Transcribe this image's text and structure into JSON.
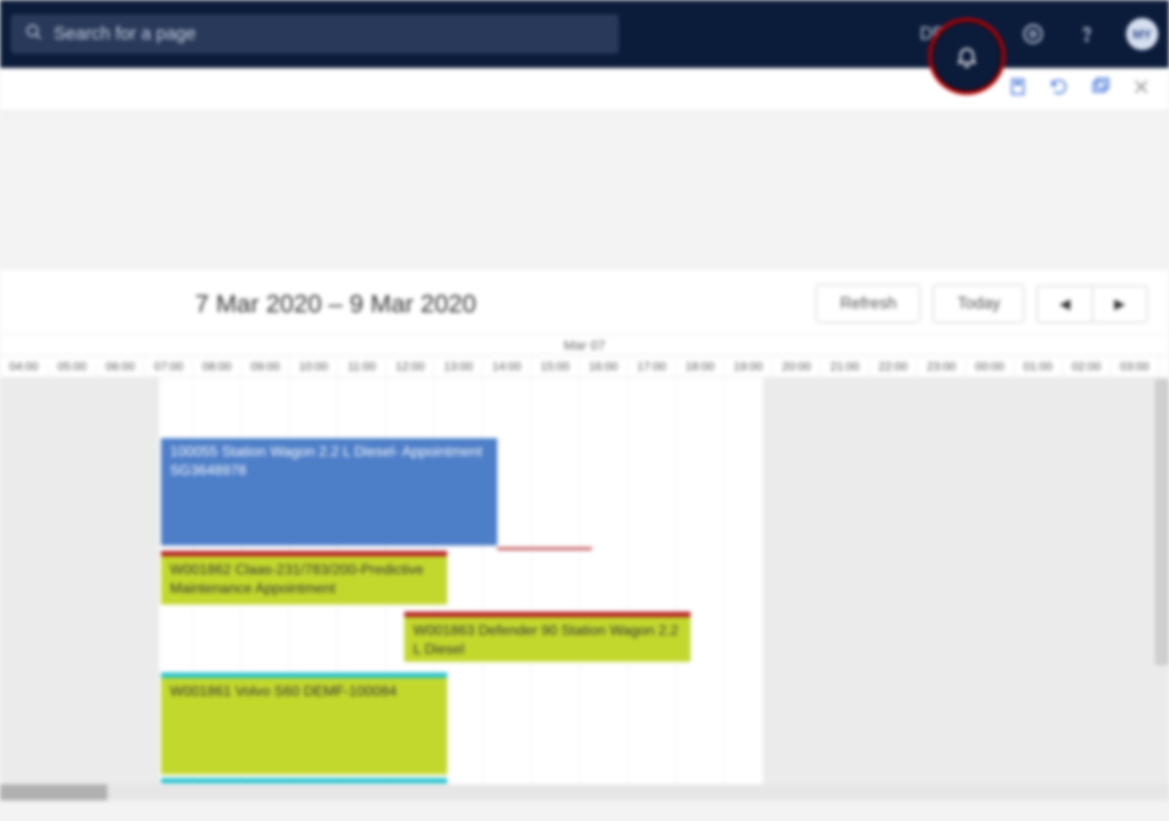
{
  "header": {
    "search_placeholder": "Search for a page",
    "company": "DEMF",
    "avatar": "MY"
  },
  "subtoolbar": {
    "office_icon": "office-icon",
    "refresh_icon": "refresh-icon",
    "window_icon": "popout-icon",
    "close_icon": "close-icon"
  },
  "scheduler": {
    "title": "7 Mar 2020 – 9 Mar 2020",
    "refresh_label": "Refresh",
    "today_label": "Today",
    "prev_label": "◀",
    "next_label": "▶",
    "day_label": "Mar 07",
    "hours": [
      "04:00",
      "05:00",
      "06:00",
      "07:00",
      "08:00",
      "09:00",
      "10:00",
      "11:00",
      "12:00",
      "13:00",
      "14:00",
      "15:00",
      "16:00",
      "17:00",
      "18:00",
      "19:00",
      "20:00",
      "21:00",
      "22:00",
      "23:00",
      "00:00",
      "01:00",
      "02:00",
      "03:00"
    ]
  },
  "events": {
    "e1": "100055 Station Wagon 2.2 L Diesel- Appointment SG3648978",
    "e2": "W001862 Claas-231/783/200-Predictive Maintenance Appointment",
    "e3": "W001863 Defender 90 Station Wagon 2.2 L Diesel",
    "e4": "W001861 Volvo S60 DEMF-100084"
  }
}
